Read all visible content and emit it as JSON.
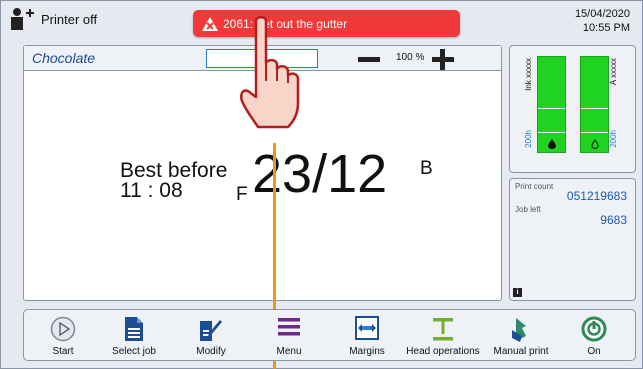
{
  "header": {
    "status_text": "Printer off",
    "date": "15/04/2020",
    "time": "10:55 PM",
    "alert_text": "2061: get out the gutter"
  },
  "job": {
    "name": "Chocolate",
    "zoom": "100 %",
    "label": {
      "best_before": "Best before",
      "time": "11 : 08",
      "f_marker": "F",
      "date": "23/12",
      "b_marker": "B"
    }
  },
  "ink": {
    "ink_label": "Ink xxxxx",
    "additive_label": "A xxxxx",
    "ink_hours": "200h",
    "additive_hours": "200h",
    "ink_level": 1.0,
    "additive_level": 1.0
  },
  "counters": {
    "print_count_label": "Print count",
    "print_count": "051219683",
    "job_left_label": "Job left",
    "job_left": "9683"
  },
  "toolbar": {
    "start": "Start",
    "select_job": "Select job",
    "modify": "Modify",
    "menu": "Menu",
    "margins": "Margins",
    "head_operations": "Head operations",
    "manual_print": "Manual print",
    "on": "On"
  },
  "colors": {
    "alert": "#f03a3a",
    "ink_green": "#21d321",
    "cursor": "#e7961e",
    "accent_blue": "#1a5ab5"
  }
}
